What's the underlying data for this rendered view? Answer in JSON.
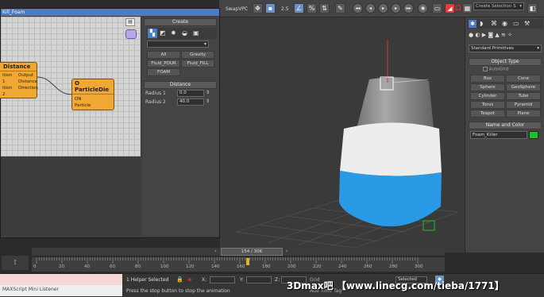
{
  "toolbar": {
    "swap_label": "SwapVPC",
    "snap_value": "2.5",
    "selection_set_placeholder": "Create Selection S"
  },
  "particle_view": {
    "title": "Kill_Foam",
    "node_distance": {
      "title": "Distance",
      "rows": [
        "Output",
        "Distance",
        "Direction"
      ],
      "left_rows": [
        "ition 1",
        "ition 2"
      ]
    },
    "node_particle_die": {
      "title": "O ParticleDie",
      "rows": [
        "ON",
        "Particle"
      ]
    },
    "create_panel": {
      "header": "Create",
      "buttons": [
        "All",
        "Gravity",
        "Fluid_POUR",
        "Fluid_FILL",
        "FOAM"
      ]
    },
    "distance_panel": {
      "header": "Distance",
      "radius1_label": "Radius 1",
      "radius1_value": "0.0",
      "radius2_label": "Radius 2",
      "radius2_value": "40.0"
    }
  },
  "command_panel": {
    "category": "Standard Primitives",
    "object_type_header": "Object Type",
    "autogrid": "AutoGrid",
    "buttons": [
      "Box",
      "Cone",
      "Sphere",
      "GeoSphere",
      "Cylinder",
      "Tube",
      "Torus",
      "Pyramid",
      "Teapot",
      "Plane"
    ],
    "name_color_header": "Name and Color",
    "name_value": "Foam_Killer",
    "color": "#22c022"
  },
  "timeline": {
    "frame_display": "154 / 306",
    "ticks": [
      "0",
      "20",
      "40",
      "60",
      "80",
      "100",
      "120",
      "140",
      "160",
      "180",
      "200",
      "220",
      "240",
      "260",
      "280",
      "300"
    ]
  },
  "status": {
    "maxscript": "MAXScript Mini Listener",
    "selected": "1 Helper Selected",
    "prompt": "Press the stop button to stop the animation",
    "x_label": "X:",
    "y_label": "Y:",
    "z_label": "Z:",
    "grid_label": "Grid",
    "selected_dropdown": "Selected",
    "add_time_tag": "Add Time Tag",
    "watermark": "3Dmax吧 【www.linecg.com/tieba/1771】"
  }
}
